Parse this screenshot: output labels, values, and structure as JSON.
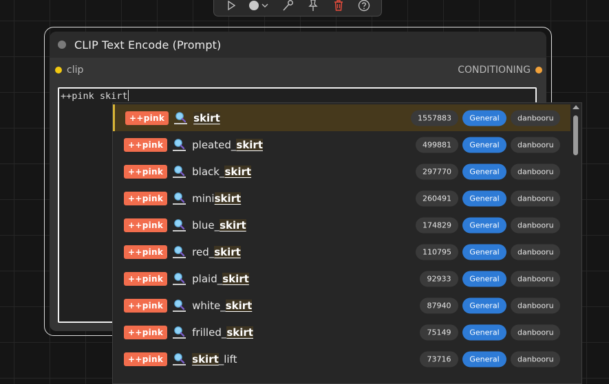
{
  "toolbar": {
    "items": [
      {
        "name": "play-icon"
      },
      {
        "name": "color-circle-icon"
      },
      {
        "name": "bypass-icon"
      },
      {
        "name": "pin-icon"
      },
      {
        "name": "trash-icon"
      },
      {
        "name": "help-icon"
      }
    ],
    "delete_color": "#e74c3c"
  },
  "node": {
    "title": "CLIP Text Encode (Prompt)",
    "input_label": "clip",
    "input_color": "#f2c811",
    "output_label": "CONDITIONING",
    "output_color": "#f2a23a",
    "prompt_text": "++pink skirt"
  },
  "autocomplete": {
    "accent": "#d7b436",
    "category_color": "#2e7bd6",
    "prefix_color": "#f26d4d",
    "items": [
      {
        "prefix": "++pink",
        "pre": "",
        "match": "skirt",
        "post": "",
        "count": "1557883",
        "category": "General",
        "source": "danbooru",
        "selected": true
      },
      {
        "prefix": "++pink",
        "pre": "pleated_",
        "match": "skirt",
        "post": "",
        "count": "499881",
        "category": "General",
        "source": "danbooru"
      },
      {
        "prefix": "++pink",
        "pre": "black_",
        "match": "skirt",
        "post": "",
        "count": "297770",
        "category": "General",
        "source": "danbooru"
      },
      {
        "prefix": "++pink",
        "pre": "mini",
        "match": "skirt",
        "post": "",
        "count": "260491",
        "category": "General",
        "source": "danbooru"
      },
      {
        "prefix": "++pink",
        "pre": "blue_",
        "match": "skirt",
        "post": "",
        "count": "174829",
        "category": "General",
        "source": "danbooru"
      },
      {
        "prefix": "++pink",
        "pre": "red_",
        "match": "skirt",
        "post": "",
        "count": "110795",
        "category": "General",
        "source": "danbooru"
      },
      {
        "prefix": "++pink",
        "pre": "plaid_",
        "match": "skirt",
        "post": "",
        "count": "92933",
        "category": "General",
        "source": "danbooru"
      },
      {
        "prefix": "++pink",
        "pre": "white_",
        "match": "skirt",
        "post": "",
        "count": "87940",
        "category": "General",
        "source": "danbooru"
      },
      {
        "prefix": "++pink",
        "pre": "frilled_",
        "match": "skirt",
        "post": "",
        "count": "75149",
        "category": "General",
        "source": "danbooru"
      },
      {
        "prefix": "++pink",
        "pre": "",
        "match": "skirt",
        "post": "_lift",
        "count": "73716",
        "category": "General",
        "source": "danbooru"
      }
    ]
  }
}
